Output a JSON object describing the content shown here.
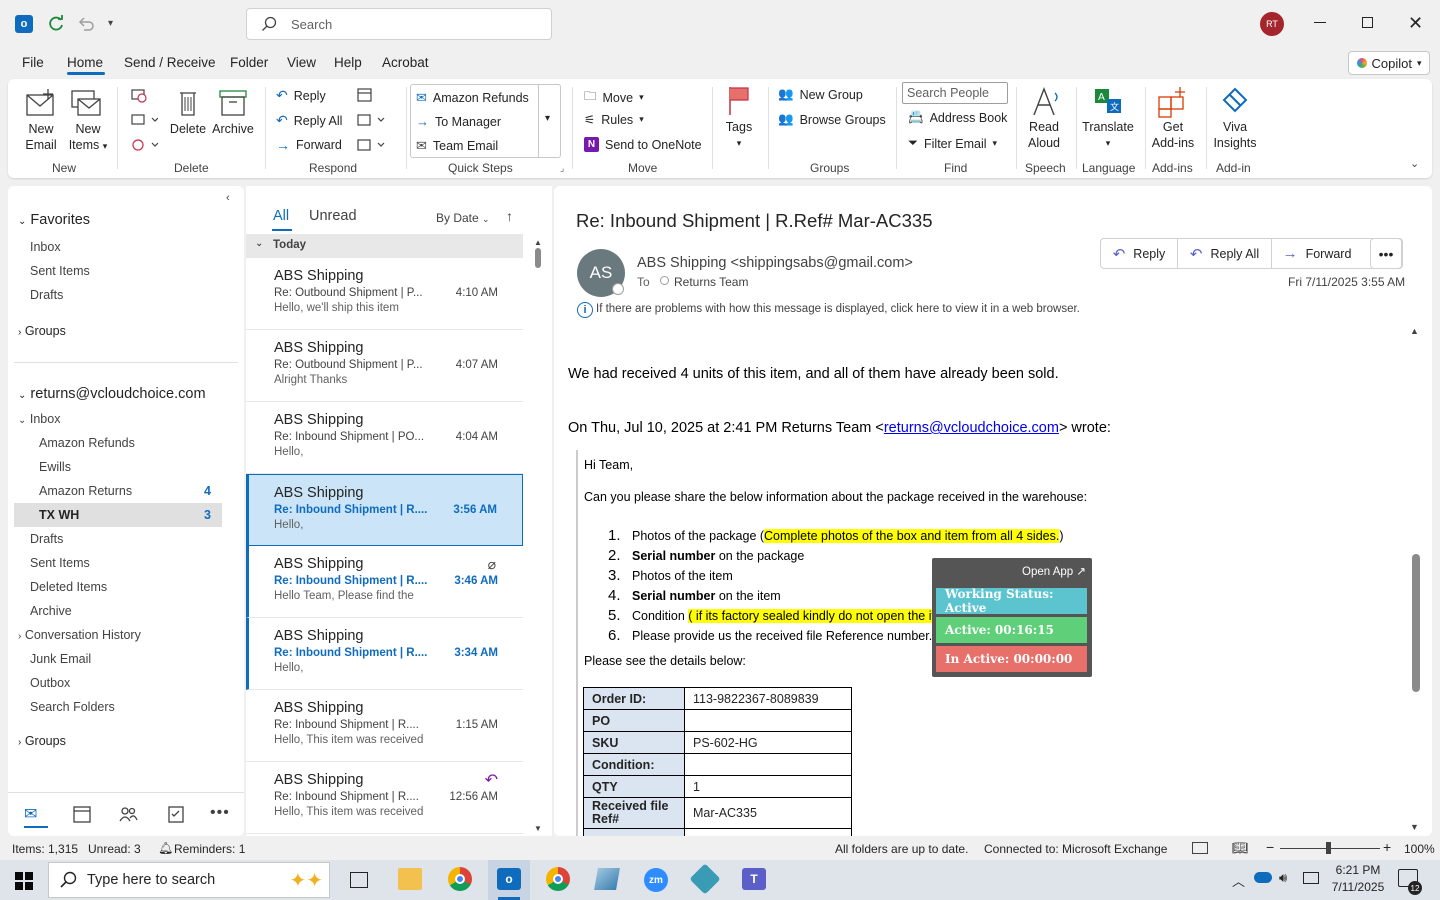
{
  "titlebar": {
    "search_placeholder": "Search",
    "avatar_initials": "RT"
  },
  "menu": {
    "items": [
      "File",
      "Home",
      "Send / Receive",
      "Folder",
      "View",
      "Help",
      "Acrobat"
    ],
    "copilot_label": "Copilot"
  },
  "ribbon": {
    "new_email": "New\nEmail",
    "new_email_l1": "New",
    "new_email_l2": "Email",
    "new_items_l1": "New",
    "new_items_l2": "Items",
    "group_new": "New",
    "delete": "Delete",
    "archive": "Archive",
    "group_delete": "Delete",
    "reply": "Reply",
    "reply_all": "Reply All",
    "forward": "Forward",
    "group_respond": "Respond",
    "quick_steps": [
      "Amazon Refunds",
      "To Manager",
      "Team Email"
    ],
    "group_quick_steps": "Quick Steps",
    "move": "Move",
    "rules": "Rules",
    "send_onenote": "Send to OneNote",
    "group_move": "Move",
    "tags": "Tags",
    "new_group": "New Group",
    "browse_groups": "Browse Groups",
    "group_groups": "Groups",
    "search_people_placeholder": "Search People",
    "address_book": "Address Book",
    "filter_email": "Filter Email",
    "group_find": "Find",
    "read_l1": "Read",
    "read_l2": "Aloud",
    "group_speech": "Speech",
    "translate": "Translate",
    "group_language": "Language",
    "get_l1": "Get",
    "get_l2": "Add-ins",
    "group_addins": "Add-ins",
    "viva_l1": "Viva",
    "viva_l2": "Insights",
    "group_addin": "Add-in"
  },
  "nav": {
    "favorites": "Favorites",
    "fav_items": [
      "Inbox",
      "Sent Items",
      "Drafts"
    ],
    "groups": "Groups",
    "account": "returns@vcloudchoice.com",
    "inbox": "Inbox",
    "sub_items": [
      {
        "label": "Amazon Refunds",
        "count": ""
      },
      {
        "label": "Ewills",
        "count": ""
      },
      {
        "label": "Amazon Returns",
        "count": "4"
      },
      {
        "label": "TX WH",
        "count": "3"
      }
    ],
    "folders": [
      "Drafts",
      "Sent Items",
      "Deleted Items",
      "Archive",
      "Conversation History",
      "Junk Email",
      "Outbox",
      "Search Folders"
    ],
    "groups2": "Groups"
  },
  "list": {
    "tab_all": "All",
    "tab_unread": "Unread",
    "sort": "By Date",
    "section": "Today",
    "messages": [
      {
        "from": "ABS Shipping",
        "subject": "Re: Outbound Shipment | P...",
        "time": "4:10 AM",
        "preview": "Hello,  we'll ship this item"
      },
      {
        "from": "ABS Shipping",
        "subject": "Re: Outbound Shipment | P...",
        "time": "4:07 AM",
        "preview": "Alright  Thanks"
      },
      {
        "from": "ABS Shipping",
        "subject": "Re: Inbound Shipment | PO...",
        "time": "4:04 AM",
        "preview": "Hello,"
      },
      {
        "from": "ABS Shipping",
        "subject": "Re: Inbound Shipment | R....",
        "time": "3:56 AM",
        "preview": "Hello,"
      },
      {
        "from": "ABS Shipping",
        "subject": "Re: Inbound Shipment | R....",
        "time": "3:46 AM",
        "preview": "Hello Team,  Please find the"
      },
      {
        "from": "ABS Shipping",
        "subject": "Re: Inbound Shipment | R....",
        "time": "3:34 AM",
        "preview": "Hello,"
      },
      {
        "from": "ABS Shipping",
        "subject": "Re: Inbound Shipment | R....",
        "time": "1:15 AM",
        "preview": "Hello,  This item was received"
      },
      {
        "from": "ABS Shipping",
        "subject": "Re: Inbound Shipment | R....",
        "time": "12:56 AM",
        "preview": "Hello,  This item was received"
      }
    ]
  },
  "reading": {
    "subject": "Re: Inbound Shipment | R.Ref# Mar-AC335",
    "sender_initials": "AS",
    "sender": "ABS Shipping <shippingsabs@gmail.com>",
    "to_label": "To",
    "to": "Returns Team",
    "reply": "Reply",
    "reply_all": "Reply All",
    "forward": "Forward",
    "date": "Fri 7/11/2025 3:55 AM",
    "info_bar": "If there are problems with how this message is displayed, click here to view it in a web browser.",
    "body_line": "We had received 4 units of this item, and all of them have already been sold.",
    "quote_prefix": "On Thu, Jul 10, 2025 at 2:41 PM Returns Team <",
    "quote_email": "returns@vcloudchoice.com",
    "quote_suffix": "> wrote:",
    "greeting": "Hi Team,",
    "request": "Can you please share the below information about the package received in the warehouse:",
    "list": {
      "i1_a": "Photos of the package (",
      "i1_hl": "Complete photos of the box and item from all 4 sides.",
      "i1_b": ")",
      "i2_bold": "Serial number",
      "i2_rest": " on the package",
      "i3": "Photos of the item",
      "i4_bold": "Serial number",
      "i4_rest": " on the item",
      "i5_a": "Condition ",
      "i5_hl": "( if its factory sealed kindly do not open the item)",
      "i6": "Please provide us the received file Reference number."
    },
    "details_intro": "Please see the details below:",
    "details": [
      {
        "k": "Order ID:",
        "v": "113-9822367-8089839"
      },
      {
        "k": "PO",
        "v": ""
      },
      {
        "k": "SKU",
        "v": "PS-602-HG"
      },
      {
        "k": "Condition:",
        "v": ""
      },
      {
        "k": "QTY",
        "v": "1"
      },
      {
        "k": "Received file Ref#",
        "v": "Mar-AC335"
      }
    ]
  },
  "widget": {
    "open_app": "Open App ↗",
    "status": "Working Status: Active",
    "active": "Active: 00:16:15",
    "inactive": "In Active: 00:00:00",
    "status_color": "#5bc4cf",
    "active_color": "#5fd079",
    "inactive_color": "#e8706a"
  },
  "status": {
    "items": "Items: 1,315",
    "unread": "Unread: 3",
    "reminders": "Reminders: 1",
    "folders": "All folders are up to date.",
    "connected": "Connected to: Microsoft Exchange",
    "zoom": "100%"
  },
  "taskbar": {
    "search_placeholder": "Type here to search",
    "time": "6:21 PM",
    "date": "7/11/2025",
    "notif_count": "12"
  },
  "colors": {
    "accent": "#0f6cbd",
    "selected_bg": "#cce4f7",
    "highlight": "#ffff00"
  }
}
